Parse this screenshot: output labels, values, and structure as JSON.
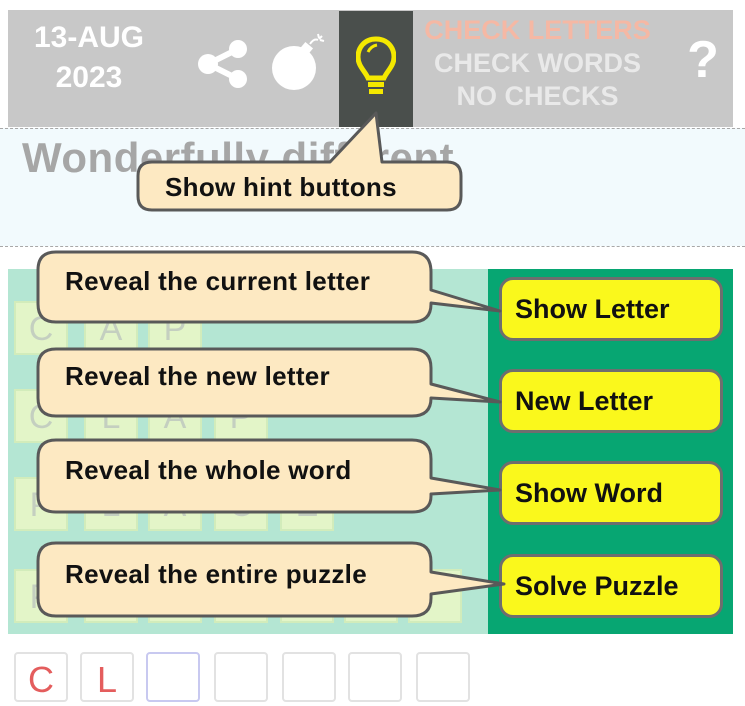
{
  "header": {
    "date_line1": "13-AUG",
    "date_line2": "2023",
    "check_options": [
      "CHECK LETTERS",
      "CHECK WORDS",
      "NO CHECKS"
    ],
    "help_symbol": "?"
  },
  "icons": {
    "share": "share-icon",
    "bomb": "bomb-icon",
    "hint": "lightbulb-icon"
  },
  "clue": {
    "text": "Wonderfully different"
  },
  "grid": {
    "rows": [
      [
        "C",
        "A",
        "P"
      ],
      [
        "C",
        "L",
        "A",
        "P"
      ],
      [
        "P",
        "L",
        "A",
        "C",
        "E"
      ],
      [
        "P",
        "",
        "",
        "",
        "",
        "",
        ""
      ]
    ]
  },
  "hint_buttons": [
    {
      "label": "Show Letter"
    },
    {
      "label": "New Letter"
    },
    {
      "label": "Show Word"
    },
    {
      "label": "Solve Puzzle"
    }
  ],
  "callouts": {
    "hint": "Show hint buttons",
    "show_letter": "Reveal the current letter",
    "new_letter": "Reveal the new letter",
    "show_word": "Reveal the whole word",
    "solve_puzzle": "Reveal the entire puzzle"
  },
  "bottom_tiles": [
    "C",
    "L",
    "",
    "",
    "",
    "",
    ""
  ],
  "colors": {
    "topbar": "#c8c8c8",
    "hint_active": "#4a4f4c",
    "lightbulb": "#f4e800",
    "panel_green": "#07a672",
    "button_yellow": "#faf81c",
    "callout_fill": "#fde9c2",
    "callout_stroke": "#595959"
  }
}
